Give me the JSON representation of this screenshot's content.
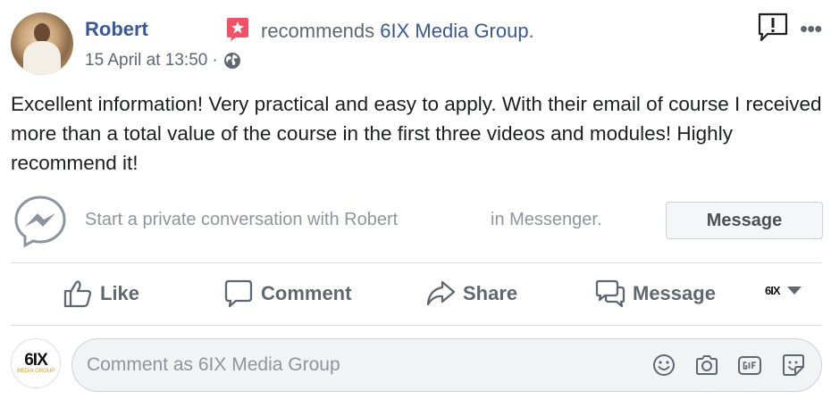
{
  "post": {
    "author": "Robert",
    "recommends_text": "recommends",
    "page_name": "6IX Media Group",
    "period": ".",
    "timestamp": "15 April at 13:50",
    "separator": "·",
    "body": "Excellent information! Very practical and easy to apply. With their email of course I received more than a total value of the course in the first three videos and modules! Highly recommend it!",
    "more_icon": "•••"
  },
  "messenger": {
    "prompt_start": "Start a private conversation with Robert",
    "prompt_end": "in Messenger.",
    "button_label": "Message"
  },
  "actions": {
    "like": "Like",
    "comment": "Comment",
    "share": "Share",
    "message": "Message",
    "page_logo": "6IX"
  },
  "comment": {
    "placeholder": "Comment as 6IX Media Group",
    "avatar_logo": "6IX",
    "avatar_sub": "MEDIA GROUP"
  },
  "colors": {
    "link": "#385898",
    "secondary_text": "#606770",
    "recommend_badge": "#f25268"
  },
  "icons": {
    "recommend": "recommend-star-icon",
    "globe": "globe-icon",
    "report": "report-icon",
    "more": "more-icon",
    "messenger": "messenger-icon",
    "like": "thumbs-up-icon",
    "comment": "comment-bubble-icon",
    "share": "share-arrow-icon",
    "message": "message-bubbles-icon",
    "emoji": "emoji-icon",
    "camera": "camera-icon",
    "gif": "gif-icon",
    "sticker": "sticker-icon"
  }
}
